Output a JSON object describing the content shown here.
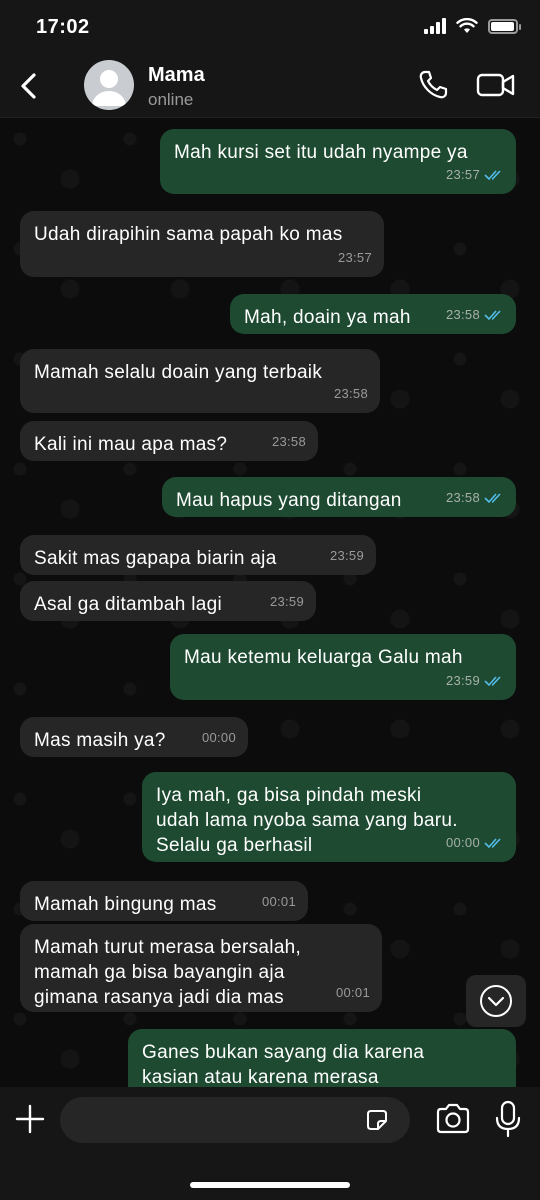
{
  "status_bar": {
    "time": "17:02",
    "battery_level": 0.95
  },
  "header": {
    "contact_name": "Mama",
    "contact_status": "online"
  },
  "messages": [
    {
      "dir": "out",
      "text": "Mah kursi set itu udah nyampe ya",
      "time": "23:57",
      "read": true
    },
    {
      "dir": "in",
      "text": "Udah dirapihin sama papah ko mas",
      "time": "23:57"
    },
    {
      "dir": "out",
      "text": "Mah, doain ya mah",
      "time": "23:58",
      "read": true
    },
    {
      "dir": "in",
      "text": "Mamah selalu doain yang terbaik",
      "time": "23:58"
    },
    {
      "dir": "in",
      "text": "Kali ini mau apa mas?",
      "time": "23:58"
    },
    {
      "dir": "out",
      "text": "Mau hapus yang ditangan",
      "time": "23:58",
      "read": true
    },
    {
      "dir": "in",
      "text": "Sakit mas gapapa biarin aja",
      "time": "23:59"
    },
    {
      "dir": "in",
      "text": "Asal ga ditambah lagi",
      "time": "23:59"
    },
    {
      "dir": "out",
      "text": "Mau ketemu keluarga Galu mah",
      "time": "23:59",
      "read": true
    },
    {
      "dir": "in",
      "text": "Mas masih ya?",
      "time": "00:00"
    },
    {
      "dir": "out",
      "text": "Iya mah, ga bisa pindah meski\nudah lama nyoba sama yang baru.\nSelalu ga berhasil",
      "time": "00:00",
      "read": true
    },
    {
      "dir": "in",
      "text": "Mamah bingung mas",
      "time": "00:01"
    },
    {
      "dir": "in",
      "text": "Mamah turut merasa bersalah,\nmamah ga bisa bayangin aja\ngimana rasanya jadi dia mas",
      "time": "00:01"
    },
    {
      "dir": "out",
      "text": "Ganes bukan sayang dia karena\nkasian atau karena merasa",
      "time": ""
    }
  ],
  "composer": {
    "input_value": ""
  },
  "colors": {
    "outgoing_bubble": "#1d4a30",
    "incoming_bubble": "#262626",
    "read_ticks": "#53bdeb"
  },
  "icons": [
    "back-chevron-icon",
    "avatar-icon",
    "phone-icon",
    "video-icon",
    "double-check-icon",
    "chevron-down-icon",
    "plus-icon",
    "sticker-icon",
    "camera-icon",
    "mic-icon"
  ]
}
